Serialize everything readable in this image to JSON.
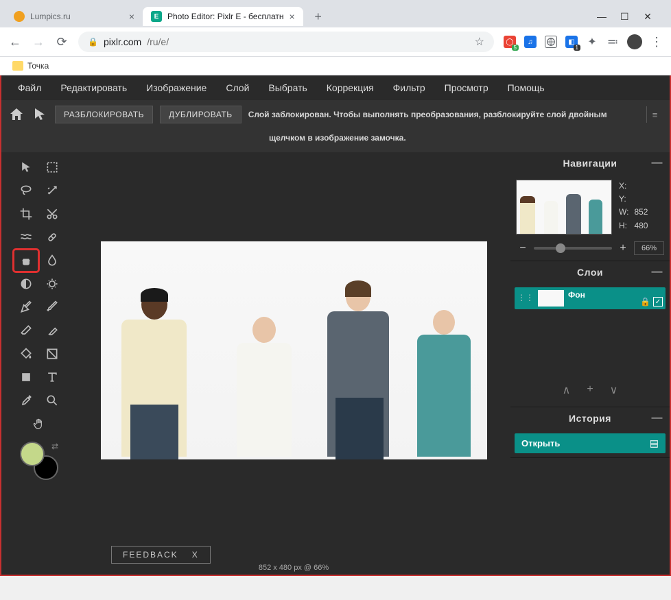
{
  "browser": {
    "tabs": [
      {
        "title": "Lumpics.ru",
        "active": false
      },
      {
        "title": "Photo Editor: Pixlr E - бесплатн",
        "active": true
      }
    ],
    "url_domain": "pixlr.com",
    "url_path": "/ru/e/",
    "bookmark": "Точка",
    "new_tab": "+"
  },
  "menu": [
    "Файл",
    "Редактировать",
    "Изображение",
    "Слой",
    "Выбрать",
    "Коррекция",
    "Фильтр",
    "Просмотр",
    "Помощь"
  ],
  "options": {
    "btn1": "РАЗБЛОКИРОВАТЬ",
    "btn2": "ДУБЛИРОВАТЬ",
    "msg1": "Слой заблокирован. Чтобы выполнять преобразования, разблокируйте слой двойным",
    "msg2": "щелчком в изображение замочка."
  },
  "nav": {
    "title": "Навигации",
    "x_label": "X:",
    "y_label": "Y:",
    "w_label": "W:",
    "h_label": "H:",
    "w_val": "852",
    "h_val": "480",
    "zoom": "66%"
  },
  "layers": {
    "title": "Слои",
    "layer1": "Фон"
  },
  "history": {
    "title": "История",
    "item1": "Открыть"
  },
  "feedback": {
    "label": "FEEDBACK",
    "close": "X"
  },
  "status": "852 x 480 px @ 66%",
  "colors": {
    "fg": "#c4d88a",
    "bg": "#000000",
    "accent": "#0a9088",
    "highlight": "#e03030"
  }
}
